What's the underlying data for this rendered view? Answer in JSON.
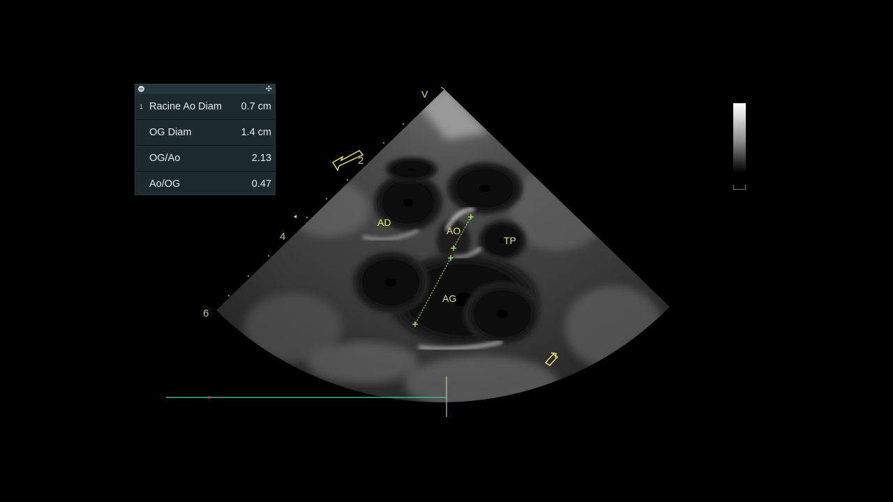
{
  "measurements": {
    "rows": [
      {
        "index": "1",
        "label": "Racine Ao Diam",
        "value": "0.7 cm"
      },
      {
        "index": "",
        "label": "OG Diam",
        "value": "1.4 cm"
      },
      {
        "index": "",
        "label": "OG/Ao",
        "value": "2.13"
      },
      {
        "index": "",
        "label": "Ao/OG",
        "value": "0.47"
      }
    ],
    "move_glyph": "✣"
  },
  "image": {
    "apex_marker": "V",
    "depth_marks": [
      "2",
      "4",
      "6"
    ],
    "anatomy_labels": {
      "ad": "AD",
      "ao": "AO",
      "tp": "TP",
      "ag": "AG"
    }
  },
  "colors": {
    "annotation": "#e8e36a",
    "caliper": "#9fe36a",
    "ecg_trace": "#3fb58d",
    "panel_bg": "#1c2a2e"
  }
}
